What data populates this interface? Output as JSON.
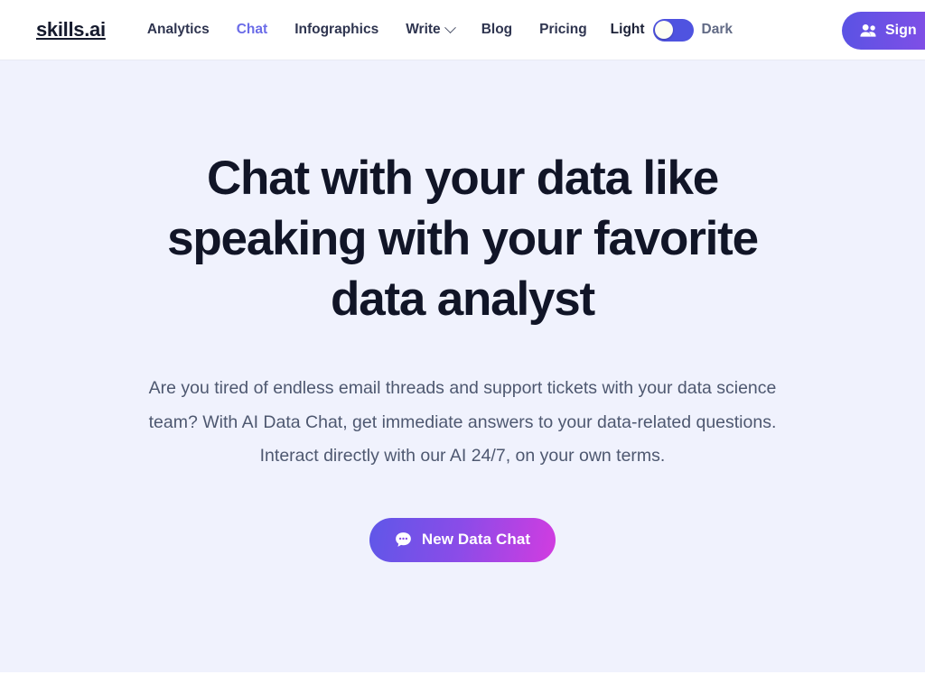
{
  "navbar": {
    "logo": "skills.ai",
    "links": [
      {
        "label": "Analytics",
        "active": false,
        "dropdown": false
      },
      {
        "label": "Chat",
        "active": true,
        "dropdown": false
      },
      {
        "label": "Infographics",
        "active": false,
        "dropdown": false
      },
      {
        "label": "Write",
        "active": false,
        "dropdown": true
      },
      {
        "label": "Blog",
        "active": false,
        "dropdown": false
      },
      {
        "label": "Pricing",
        "active": false,
        "dropdown": false
      }
    ],
    "theme": {
      "light_label": "Light",
      "dark_label": "Dark",
      "active_mode": "Light",
      "toggle_state": "off"
    },
    "signup": {
      "label": "Sign",
      "icon": "users-icon"
    },
    "colors": {
      "active_link": "#6b6ce8",
      "link": "#2f3550",
      "logo": "#151a2d",
      "toggle_track": "#4f53e0",
      "background": "#ffffff",
      "border": "#e8eaf3"
    }
  },
  "hero": {
    "title": "Chat with your data like speaking with your favorite data analyst",
    "subtitle": "Are you tired of endless email threads and support tickets with your data science team? With AI Data Chat, get immediate answers to your data-related questions. Interact directly with our AI 24/7, on your own terms.",
    "cta": {
      "label": "New Data Chat",
      "icon": "chat-bubble-icon"
    },
    "colors": {
      "background": "#f0f2fd",
      "title": "#111527",
      "subtitle": "#4e5870",
      "cta_gradient_start": "#5f57e8",
      "cta_gradient_mid": "#8a4ce8",
      "cta_gradient_end": "#d23ce0"
    }
  }
}
